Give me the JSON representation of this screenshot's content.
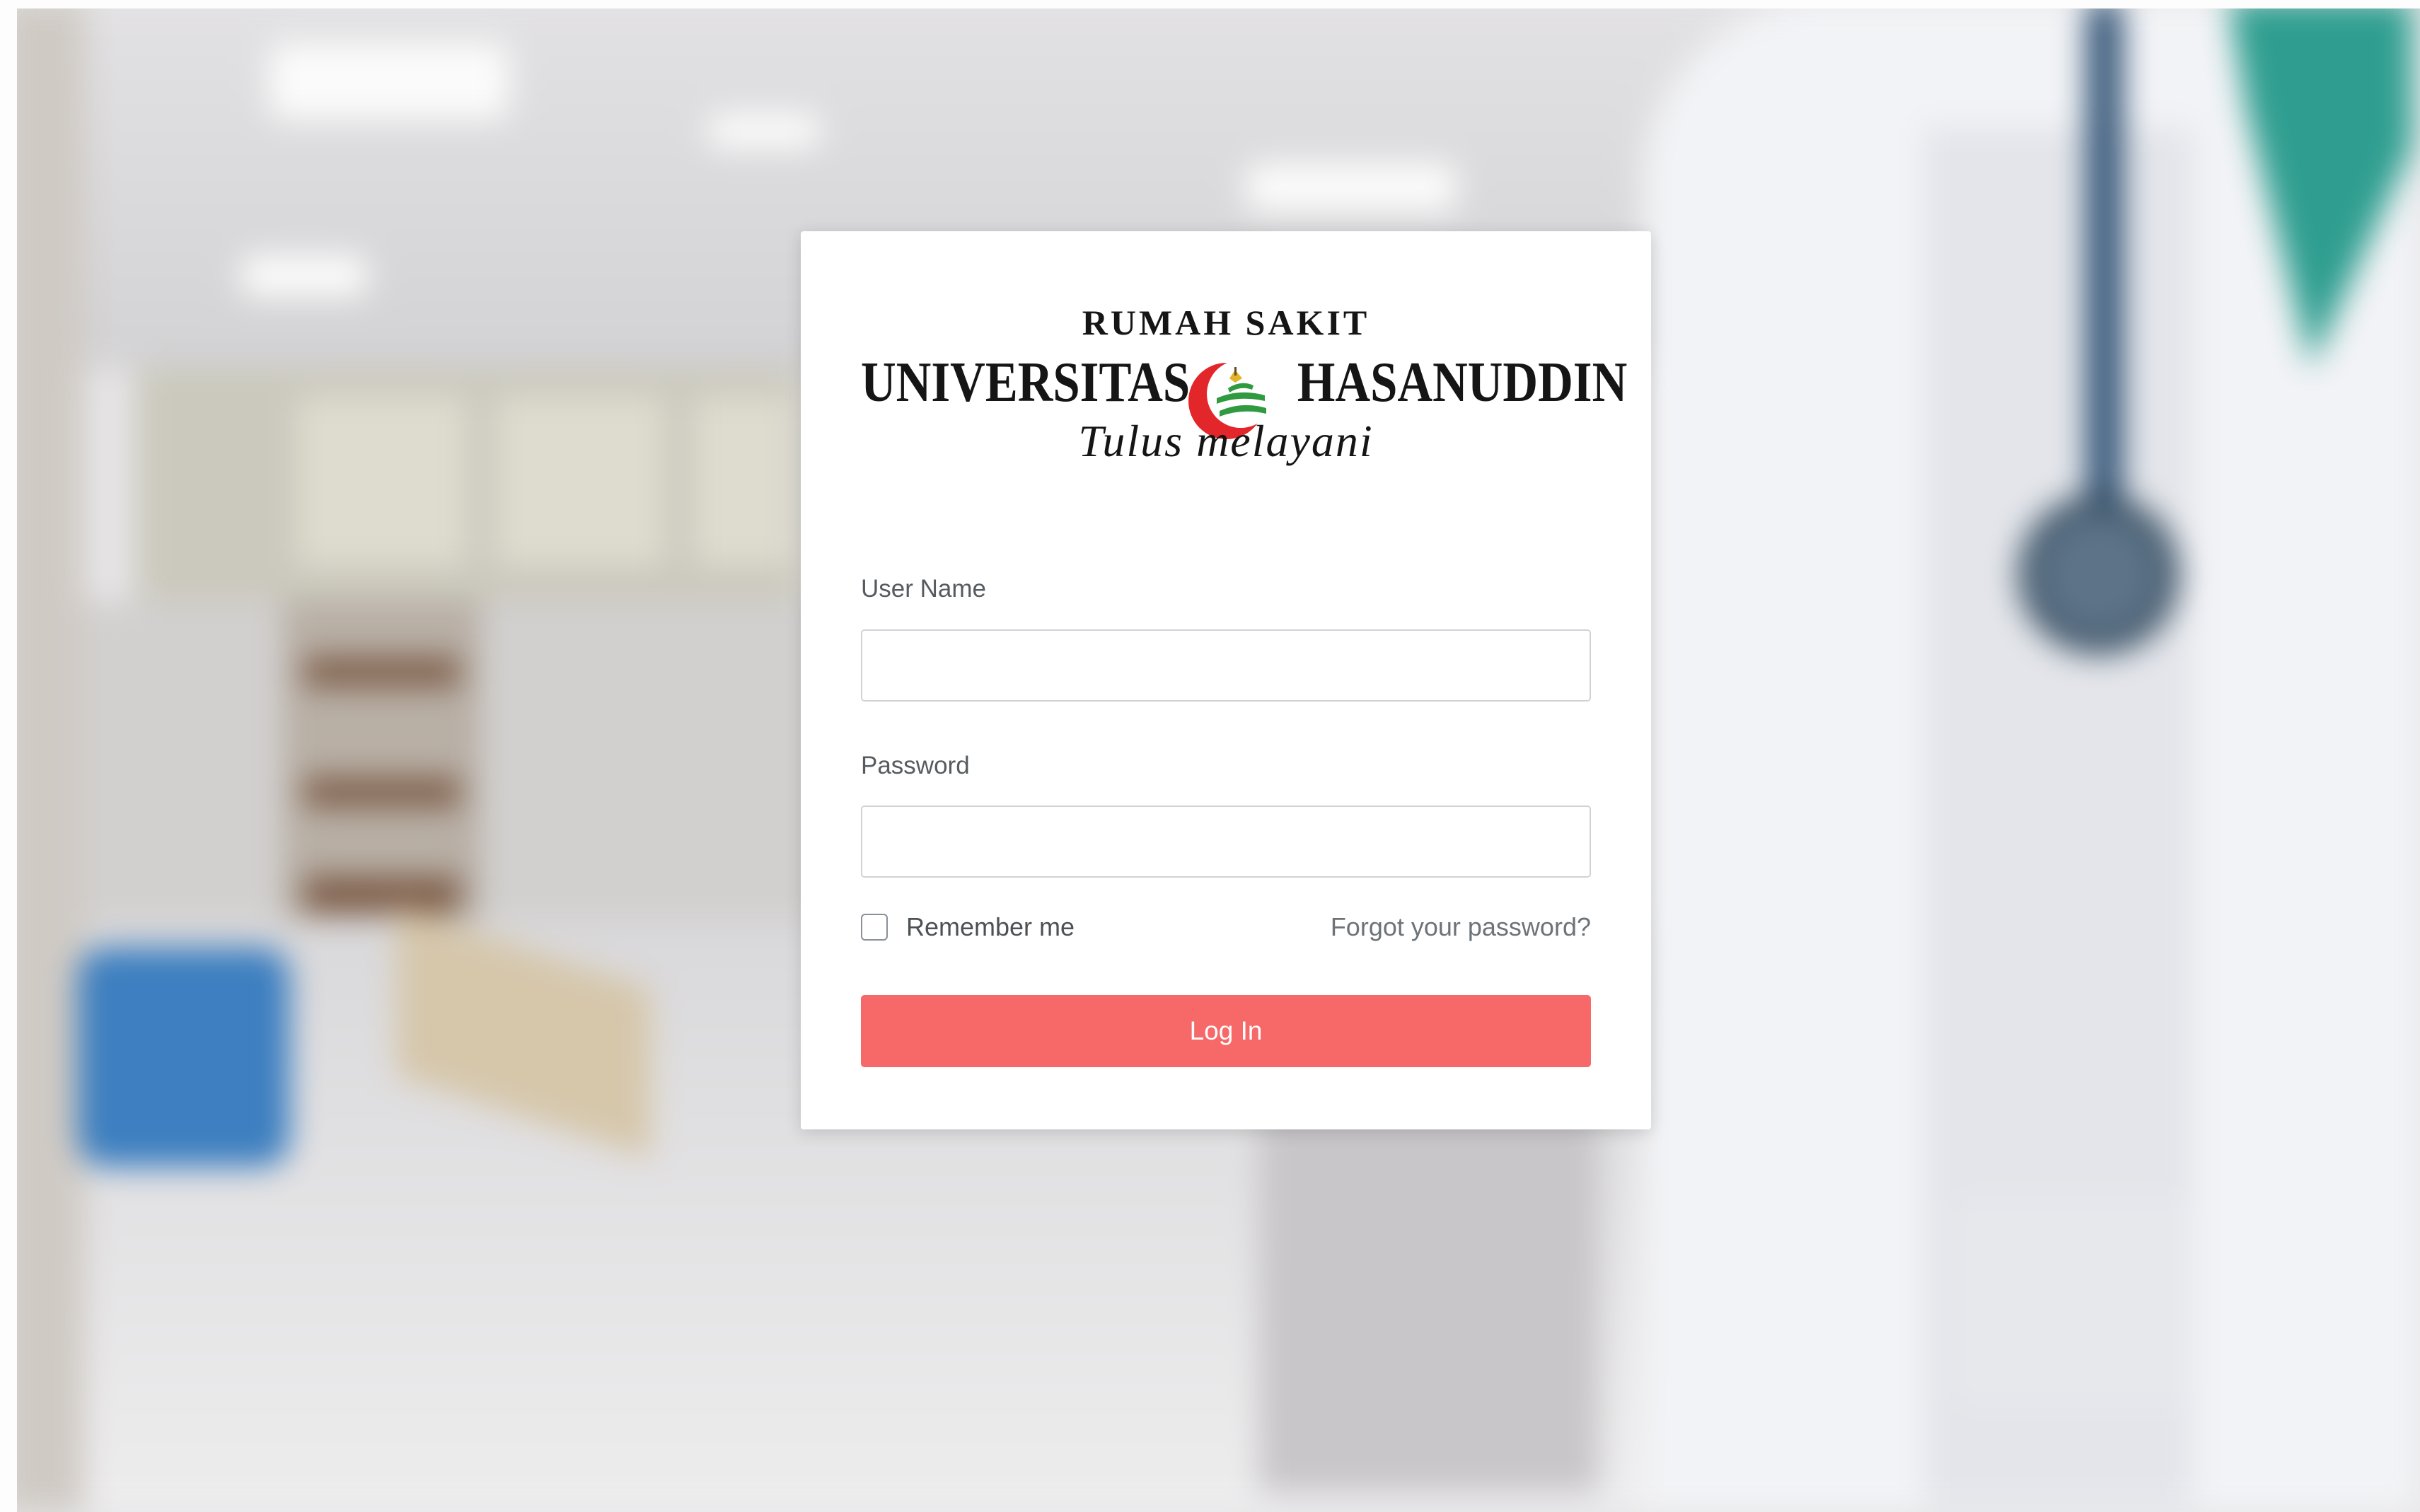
{
  "logo": {
    "line1": "RUMAH SAKIT",
    "word_left": "UNIVERSITAS",
    "word_right": "HASANUDDIN",
    "tagline": "Tulus melayani",
    "accent_red": "#e3262a",
    "accent_green": "#2f9a3f"
  },
  "form": {
    "username_label": "User Name",
    "username_value": "",
    "password_label": "Password",
    "password_value": "",
    "remember_label": "Remember me",
    "remember_checked": false,
    "forgot_link": "Forgot your password?",
    "submit_label": "Log In"
  },
  "colors": {
    "primary_button": "#f76868",
    "card_background": "#ffffff"
  }
}
